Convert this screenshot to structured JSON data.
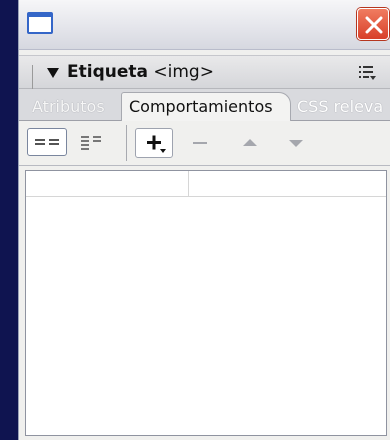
{
  "window": {
    "close_icon": "close-icon",
    "app_icon": "window-icon"
  },
  "panel": {
    "title_bold": "Etiqueta",
    "title_rest": " <img>",
    "options_icon": "panel-options-icon"
  },
  "tabs": [
    {
      "label": "Atributos",
      "active": false
    },
    {
      "label": "Comportamientos",
      "active": true
    },
    {
      "label": "CSS releva",
      "active": false
    }
  ],
  "toolbar": {
    "show_set_icon": "show-set-events-icon",
    "show_all_icon": "show-all-events-icon",
    "add_icon": "add-behavior-icon",
    "add_symbol": "+",
    "remove_icon": "remove-behavior-icon",
    "up_icon": "move-up-icon",
    "down_icon": "move-down-icon"
  },
  "behaviors_list": {
    "rows": []
  },
  "colors": {
    "desktop_bg": "#0f1450",
    "close_red": "#d8402a",
    "accent_blue": "#3466c8"
  }
}
